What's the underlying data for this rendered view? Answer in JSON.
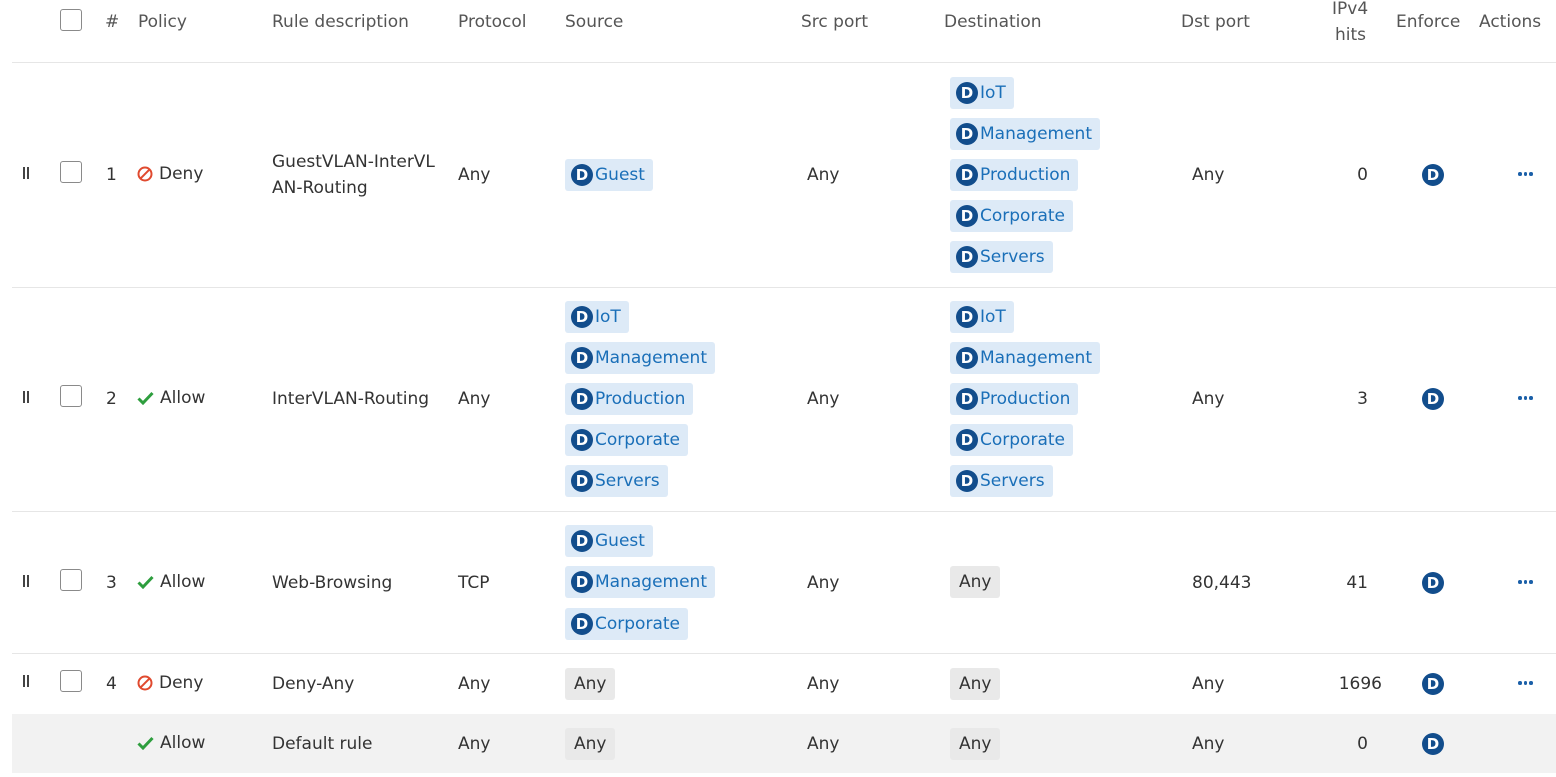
{
  "header": {
    "num": "#",
    "policy": "Policy",
    "description": "Rule description",
    "protocol": "Protocol",
    "source": "Source",
    "src_port": "Src port",
    "destination": "Destination",
    "dst_port": "Dst port",
    "hits_line1": "IPv4",
    "hits_line2": "hits",
    "enforce": "Enforce",
    "actions": "Actions"
  },
  "badge_letter": "D",
  "colors": {
    "deny": "#e04a2f",
    "allow": "#2e9e3e",
    "tag_bg": "#ddeaf7",
    "tag_text": "#1a6fb8",
    "badge": "#124d8c"
  },
  "rows": [
    {
      "num": "1",
      "policy": "Deny",
      "description": "GuestVLAN-InterVLAN-Routing",
      "protocol": "Any",
      "source": [
        "Guest"
      ],
      "src_port": "Any",
      "destination": [
        "IoT",
        "Management",
        "Production",
        "Corporate",
        "Servers"
      ],
      "dst_port": "Any",
      "hits": "0"
    },
    {
      "num": "2",
      "policy": "Allow",
      "description": "InterVLAN-Routing",
      "protocol": "Any",
      "source": [
        "IoT",
        "Management",
        "Production",
        "Corporate",
        "Servers"
      ],
      "src_port": "Any",
      "destination": [
        "IoT",
        "Management",
        "Production",
        "Corporate",
        "Servers"
      ],
      "dst_port": "Any",
      "hits": "3"
    },
    {
      "num": "3",
      "policy": "Allow",
      "description": "Web-Browsing",
      "protocol": "TCP",
      "source": [
        "Guest",
        "Management",
        "Corporate"
      ],
      "src_port": "Any",
      "destination_any": "Any",
      "dst_port": "80,443",
      "hits": "41"
    },
    {
      "num": "4",
      "policy": "Deny",
      "description": "Deny-Any",
      "protocol": "Any",
      "source_any": "Any",
      "src_port": "Any",
      "destination_any": "Any",
      "dst_port": "Any",
      "hits": "1696"
    }
  ],
  "default_row": {
    "policy": "Allow",
    "description": "Default rule",
    "protocol": "Any",
    "source_any": "Any",
    "src_port": "Any",
    "destination_any": "Any",
    "dst_port": "Any",
    "hits": "0"
  }
}
